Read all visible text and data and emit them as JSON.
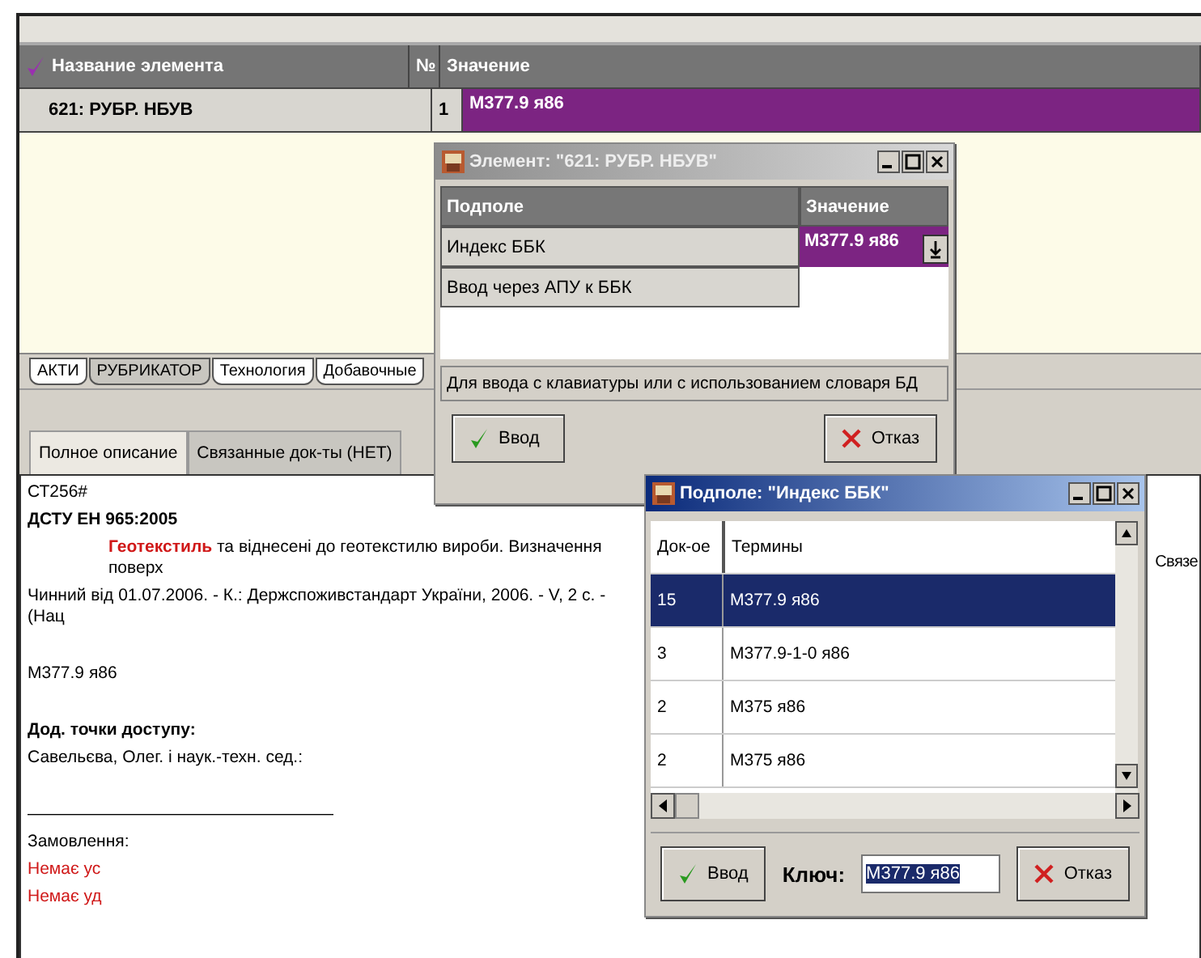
{
  "main_grid": {
    "columns": [
      "Название элемента",
      "№",
      "Значение"
    ],
    "rows": [
      {
        "cells": [
          "621: РУБР. НБУВ",
          "1",
          "М377.9 я86"
        ],
        "selected": true
      }
    ]
  },
  "tabs": [
    {
      "label": "АКТИ",
      "selected": false
    },
    {
      "label": "РУБРИКАТОР",
      "selected": true
    },
    {
      "label": "Технология",
      "selected": false
    },
    {
      "label": "Добавочные",
      "selected": false
    }
  ],
  "subtabs": [
    {
      "label": "Полное описание",
      "selected": true
    },
    {
      "label": "Связанные док-ты (НЕТ)",
      "selected": false
    }
  ],
  "description": [
    {
      "kind": "plain",
      "text": "СТ256#"
    },
    {
      "kind": "bold",
      "text": "ДСТУ EH 965:2005"
    },
    {
      "kind": "indented",
      "text": "**Геотекстиль** та віднесені до геотекстилю вироби. Визначення поверх"
    },
    {
      "kind": "plain",
      "text": "Чинний від 01.07.2006. - К.: Держспоживстандарт України, 2006. - V, 2 с. - (Нац"
    },
    {
      "kind": "plain",
      "text": "М377.9 я86"
    },
    {
      "kind": "bold",
      "text": "Дод. точки доступу:"
    },
    {
      "kind": "plain",
      "text": "Савельєва, Олег. і наук.-техн. сед.:"
    },
    {
      "kind": "plain",
      "text": "——————————————————"
    },
    {
      "kind": "plain",
      "text": "Замовлення:"
    },
    {
      "kind": "red",
      "text": "Немає ус"
    },
    {
      "kind": "red",
      "text": "Немає уд"
    }
  ],
  "side_text": "Связе",
  "element_dialog": {
    "title": "Элемент: \"621: РУБР. НБУВ\"",
    "active": false,
    "columns": [
      "Подполе",
      "Значение"
    ],
    "rows": [
      {
        "label": "Индекс ББК",
        "value": "М377.9 я86",
        "selected": true
      },
      {
        "label": "Ввод через АПУ к ББК",
        "selected": false
      }
    ],
    "hint": "Для ввода с клавиатуры или с использованием словаря БД",
    "buttons": [
      {
        "kind": "ok",
        "label": "Ввод"
      },
      {
        "kind": "cancel",
        "label": "Отказ"
      }
    ]
  },
  "subfield_dialog": {
    "title": "Подполе: \"Индекс ББК\"",
    "active": true,
    "columns": [
      "Док-ое",
      "Термины"
    ],
    "rows": [
      {
        "count": "15",
        "term": "М377.9 я86",
        "selected": true
      },
      {
        "count": "3",
        "term": "М377.9-1-0 я86",
        "selected": false
      },
      {
        "count": "2",
        "term": "М375 я86",
        "selected": false
      },
      {
        "count": "2",
        "term": "М375 я86",
        "selected": false
      }
    ],
    "key_label": "Ключ:",
    "key_value": "М377.9 я86",
    "buttons": [
      {
        "kind": "ok",
        "label": "Ввод"
      },
      {
        "kind": "cancel",
        "label": "Отказ"
      }
    ]
  }
}
